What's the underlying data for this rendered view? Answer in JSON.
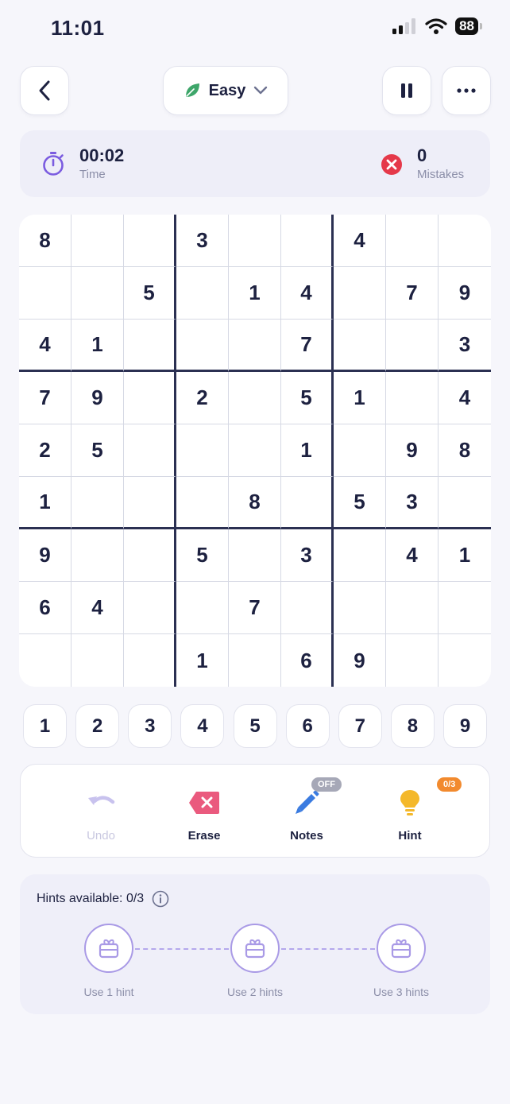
{
  "status_bar": {
    "time": "11:01",
    "battery": "88"
  },
  "header": {
    "difficulty": "Easy"
  },
  "stats": {
    "time_value": "00:02",
    "time_label": "Time",
    "mistakes_value": "0",
    "mistakes_label": "Mistakes"
  },
  "board": [
    [
      "8",
      "",
      "",
      "3",
      "",
      "",
      "4",
      "",
      ""
    ],
    [
      "",
      "",
      "5",
      "",
      "1",
      "4",
      "",
      "7",
      "9"
    ],
    [
      "4",
      "1",
      "",
      "",
      "",
      "7",
      "",
      "",
      "3"
    ],
    [
      "7",
      "9",
      "",
      "2",
      "",
      "5",
      "1",
      "",
      "4"
    ],
    [
      "2",
      "5",
      "",
      "",
      "",
      "1",
      "",
      "9",
      "8"
    ],
    [
      "1",
      "",
      "",
      "",
      "8",
      "",
      "5",
      "3",
      ""
    ],
    [
      "9",
      "",
      "",
      "5",
      "",
      "3",
      "",
      "4",
      "1"
    ],
    [
      "6",
      "4",
      "",
      "",
      "7",
      "",
      "",
      "",
      ""
    ],
    [
      "",
      "",
      "",
      "1",
      "",
      "6",
      "9",
      "",
      ""
    ]
  ],
  "number_pad": [
    "1",
    "2",
    "3",
    "4",
    "5",
    "6",
    "7",
    "8",
    "9"
  ],
  "tools": {
    "undo_label": "Undo",
    "erase_label": "Erase",
    "notes_label": "Notes",
    "notes_badge": "OFF",
    "hint_label": "Hint",
    "hint_badge": "0/3"
  },
  "hints_panel": {
    "title": "Hints available: 0/3",
    "steps": [
      {
        "label": "Use 1 hint"
      },
      {
        "label": "Use 2 hints"
      },
      {
        "label": "Use 3 hints"
      }
    ]
  },
  "colors": {
    "accent_purple": "#7b5ce0",
    "leaf_green": "#3ea66a",
    "mistake_red": "#e5394a",
    "erase_pink": "#ea5a7e",
    "notes_blue": "#3a7be0",
    "hint_yellow": "#f4b82a"
  }
}
